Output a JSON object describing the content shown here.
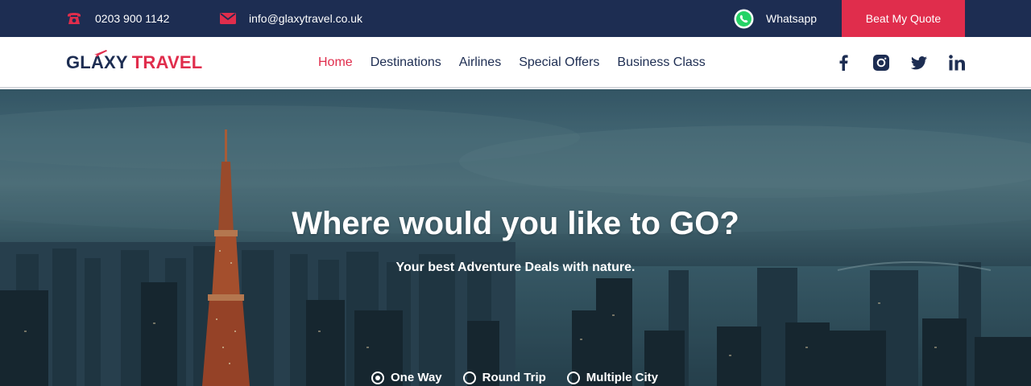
{
  "topbar": {
    "phone": "0203 900 1142",
    "email": "info@glaxytravel.co.uk",
    "whatsapp_label": "Whatsapp",
    "quote_button": "Beat My Quote",
    "icons": {
      "phone": "phone-icon",
      "email": "envelope-icon",
      "whatsapp": "whatsapp-icon"
    },
    "colors": {
      "bar": "#1d2d52",
      "accent": "#e02d4c"
    }
  },
  "logo": {
    "part1": "GLAXY",
    "part2": "TRAVEL"
  },
  "nav": {
    "items": [
      {
        "label": "Home",
        "active": true
      },
      {
        "label": "Destinations",
        "active": false
      },
      {
        "label": "Airlines",
        "active": false
      },
      {
        "label": "Special Offers",
        "active": false
      },
      {
        "label": "Business Class",
        "active": false
      }
    ]
  },
  "social": [
    "facebook-icon",
    "instagram-icon",
    "twitter-icon",
    "linkedin-icon"
  ],
  "hero": {
    "title": "Where would you like to GO?",
    "subtitle": "Your best Adventure Deals with nature.",
    "trip_types": [
      {
        "label": "One Way",
        "selected": true
      },
      {
        "label": "Round Trip",
        "selected": false
      },
      {
        "label": "Multiple City",
        "selected": false
      }
    ]
  }
}
